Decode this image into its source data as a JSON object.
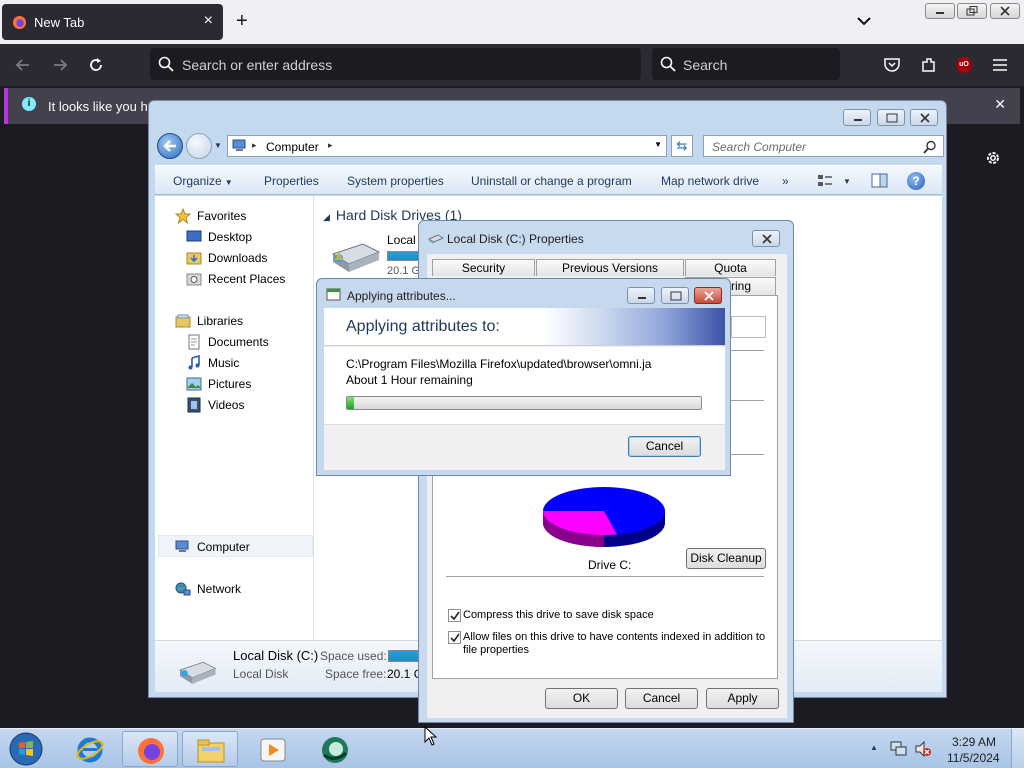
{
  "firefox": {
    "tab_title": "New Tab",
    "address_placeholder": "Search or enter address",
    "search_placeholder": "Search",
    "notice_text": "It looks like you hav",
    "ublock_label": "uO"
  },
  "explorer": {
    "breadcrumb": "Computer",
    "search_placeholder": "Search Computer",
    "commands": [
      "Organize",
      "Properties",
      "System properties",
      "Uninstall or change a program",
      "Map network drive"
    ],
    "more_chevron": "»",
    "nav": {
      "favorites": "Favorites",
      "desktop": "Desktop",
      "downloads": "Downloads",
      "recent_places": "Recent Places",
      "libraries": "Libraries",
      "documents": "Documents",
      "music": "Music",
      "pictures": "Pictures",
      "videos": "Videos",
      "computer": "Computer",
      "network": "Network"
    },
    "group_header": "Hard Disk Drives (1)",
    "drive_name": "Local",
    "drive_free": "20.1 G",
    "details": {
      "name": "Local Disk (C:)",
      "type": "Local Disk",
      "space_used_label": "Space used:",
      "space_free_label": "Space free:",
      "space_free_value": "20.1 G"
    }
  },
  "properties": {
    "title": "Local Disk (C:) Properties",
    "tabs": [
      "Security",
      "Previous Versions",
      "Quota"
    ],
    "tab_partial": "aring",
    "drive_label": "Drive C:",
    "disk_cleanup": "Disk Cleanup",
    "compress_label": "Compress this drive to save disk space",
    "index_label": "Allow files on this drive to have contents indexed in addition to file properties",
    "compress_checked": true,
    "index_checked": true,
    "ok": "OK",
    "cancel": "Cancel",
    "apply": "Apply"
  },
  "applying": {
    "title": "Applying attributes...",
    "heading": "Applying attributes to:",
    "path": "C:\\Program Files\\Mozilla Firefox\\updated\\browser\\omni.ja",
    "time_remaining": "About 1 Hour remaining",
    "progress_percent": 2,
    "cancel": "Cancel"
  },
  "taskbar": {
    "time": "3:29 AM",
    "date": "11/5/2024"
  },
  "colors": {
    "used_space": "#0000ff",
    "free_space": "#ff00ff",
    "firefox_dark": "#2b2a33",
    "notice_accent": "#b833e1"
  }
}
